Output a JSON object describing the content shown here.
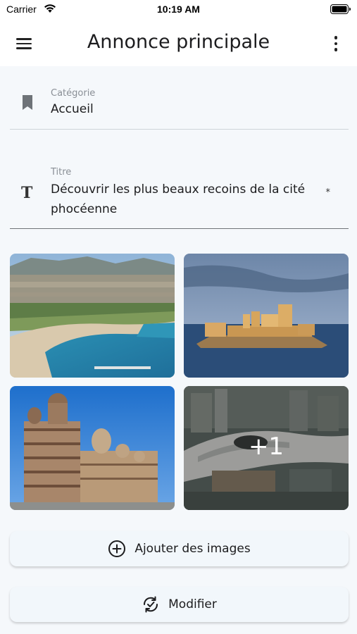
{
  "status_bar": {
    "carrier": "Carrier",
    "time": "10:19 AM",
    "icons": [
      "wifi-icon",
      "battery-icon"
    ]
  },
  "app_bar": {
    "title": "Annonce principale",
    "icons": [
      "menu-icon",
      "more-vertical-icon"
    ]
  },
  "fields": {
    "category": {
      "label": "Catégorie",
      "value": "Accueil",
      "icon": "bookmark-icon"
    },
    "title": {
      "label": "Titre",
      "value": "Découvrir les plus beaux recoins de la cité phocéenne",
      "required_mark": "*",
      "icon": "text-icon"
    }
  },
  "gallery": {
    "extra_count_label": "+1"
  },
  "buttons": {
    "add_images": {
      "label": "Ajouter des images",
      "icon": "add-circle-icon"
    },
    "edit": {
      "label": "Modifier",
      "icon": "sync-check-icon"
    }
  },
  "colors": {
    "background": "#f5f8fb",
    "button_background": "#f2f7fb",
    "text": "#1c1c1e",
    "label": "#8a8f96"
  }
}
